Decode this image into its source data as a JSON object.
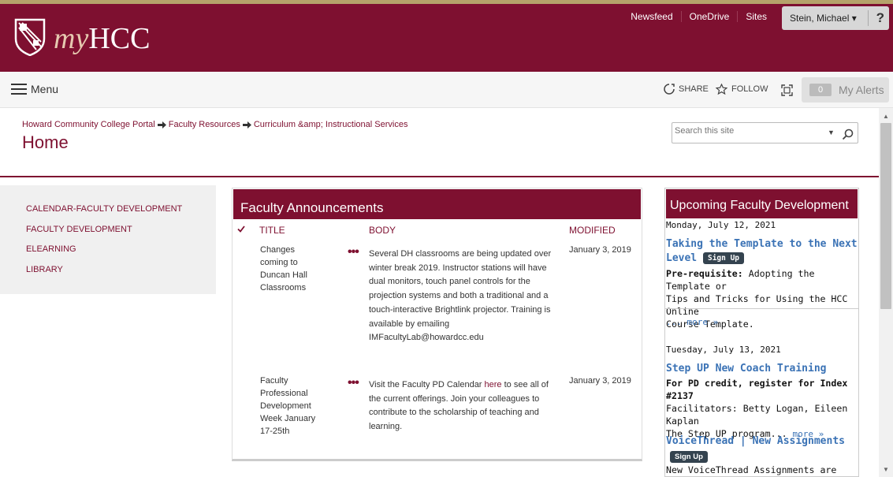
{
  "header": {
    "logo_prefix": "my",
    "logo_name": "HCC",
    "links": [
      "Newsfeed",
      "OneDrive",
      "Sites"
    ],
    "user": "Stein, Michael ▾",
    "help": "?"
  },
  "suitebar": {
    "menu_label": "Menu",
    "share_label": "SHARE",
    "follow_label": "FOLLOW",
    "alert_count": "0",
    "alerts_label": "My Alerts"
  },
  "breadcrumb": [
    "Howard Community College Portal",
    "Faculty Resources",
    "Curriculum &amp; Instructional Services"
  ],
  "page_title": "Home",
  "search": {
    "placeholder": "Search this site"
  },
  "leftnav": {
    "items": [
      "CALENDAR-FACULTY DEVELOPMENT",
      "FACULTY DEVELOPMENT",
      "ELEARNING",
      "LIBRARY"
    ]
  },
  "announcements": {
    "title": "Faculty Announcements",
    "columns": {
      "title": "TITLE",
      "body": "BODY",
      "modified": "MODIFIED"
    },
    "rows": [
      {
        "title_lines": [
          "Changes",
          "coming to",
          "Duncan Hall",
          "Classrooms"
        ],
        "body_lines": [
          "Several DH classrooms are being updated over",
          "winter break 2019. Instructor stations will have",
          "dual monitors, touch panel controls for the",
          "projection systems and both a traditional and a",
          "touch-interactive Brightlink projector. Training is",
          "available by emailing",
          "IMFacultyLab@howardcc.edu"
        ],
        "modified": "January 3, 2019"
      },
      {
        "title_lines": [
          "Faculty",
          "Professional",
          "Development",
          "Week January",
          "17-25th"
        ],
        "body_before": "Visit the Faculty PD Calendar ",
        "body_link": "here",
        "body_after": " to see all of",
        "body_lines": [
          "the current offerings. Join your colleagues to",
          "contribute to the scholarship of teaching and",
          "learning."
        ],
        "modified": "January 3, 2019"
      }
    ]
  },
  "upcoming": {
    "title": "Upcoming Faculty Development",
    "signup_label": "Sign Up",
    "more_label": "more »",
    "events": [
      {
        "date": "Monday, July 12, 2021",
        "title_line1": "Taking the Template to the Next",
        "title_line2": "Level",
        "text_bold": "Pre-requisite:",
        "text_rest": "  Adopting the Template or",
        "text_lines": [
          "Tips and Tricks for Using the HCC Online",
          "Course Template."
        ],
        "more": "... more »"
      },
      {
        "date": "Tuesday, July 13, 2021",
        "title": "Step UP New Coach Training",
        "bold_lines": [
          "For PD credit, register for Index",
          "#2137"
        ],
        "text_line": "Facilitators: Betty Logan, Eileen Kaplan",
        "text_tail": "The Step UP program...",
        "more": "more »"
      },
      {
        "title": "VoiceThread | New Assignments",
        "text_line": "New VoiceThread Assignments are here! If"
      }
    ]
  }
}
